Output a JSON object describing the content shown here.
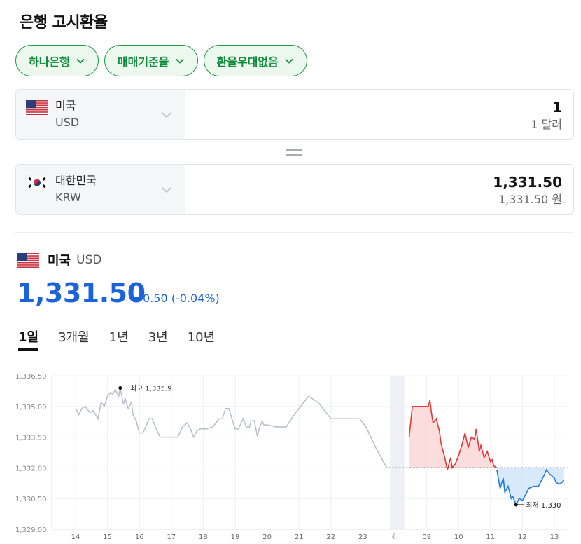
{
  "page_title": "은행 고시환율",
  "filters": [
    {
      "label": "하나은행"
    },
    {
      "label": "매매기준율"
    },
    {
      "label": "환율우대없음"
    }
  ],
  "from_currency": {
    "name": "미국",
    "code": "USD",
    "amount": "1",
    "amount_sub": "1 달러"
  },
  "to_currency": {
    "name": "대한민국",
    "code": "KRW",
    "amount": "1,331.50",
    "amount_sub": "1,331.50 원"
  },
  "summary": {
    "name": "미국",
    "code": "USD",
    "price": "1,331.50",
    "change": "0.50 (-0.04%)",
    "change_direction": "down"
  },
  "period_tabs": [
    {
      "label": "1일",
      "active": true
    },
    {
      "label": "3개월",
      "active": false
    },
    {
      "label": "1년",
      "active": false
    },
    {
      "label": "3년",
      "active": false
    },
    {
      "label": "10년",
      "active": false
    }
  ],
  "colors": {
    "accent_green": "#0d8a3a",
    "price_blue": "#1a63d8",
    "up_red": "#e53935",
    "down_blue": "#1e7be0",
    "history_gray": "#b7bcc9"
  },
  "chart_data": {
    "type": "line",
    "ylim": [
      1329.0,
      1336.5
    ],
    "yticks": [
      "1,336.50",
      "1,335.00",
      "1,333.50",
      "1,332.00",
      "1,330.50",
      "1,329.00"
    ],
    "xticks": [
      "14",
      "15",
      "16",
      "17",
      "18",
      "19",
      "20",
      "21",
      "22",
      "23",
      "☾",
      "09",
      "10",
      "11",
      "12",
      "13"
    ],
    "reference_value": 1332.0,
    "max_label": "최고 1,335.9",
    "min_label": "최저 1,330",
    "series": [
      {
        "x": [
          0.0,
          0.1,
          0.2,
          0.3,
          0.45,
          0.55,
          0.7,
          0.8,
          0.9,
          1.0,
          1.1,
          1.15,
          1.25,
          1.35,
          1.4,
          1.5,
          1.55,
          1.65,
          1.75,
          1.8,
          1.9,
          2.0,
          2.1,
          2.2,
          2.3,
          2.4,
          2.5,
          2.65,
          2.8,
          2.9,
          3.05,
          3.2,
          3.35,
          3.5,
          3.6,
          3.7,
          3.8,
          3.9,
          4.1,
          4.3,
          4.5,
          4.6,
          4.7,
          4.8,
          4.9,
          5.0,
          5.1,
          5.25,
          5.35,
          5.45,
          5.5,
          5.6,
          5.7,
          5.75,
          5.85,
          5.9,
          6.0,
          6.3,
          6.6,
          6.8,
          7.0,
          7.3,
          7.6,
          8.0,
          8.4,
          8.7,
          8.9,
          9.1,
          9.4,
          9.75
        ],
        "y": [
          1334.9,
          1334.6,
          1334.9,
          1335.0,
          1334.7,
          1334.8,
          1334.4,
          1335.2,
          1335.0,
          1335.5,
          1335.7,
          1335.6,
          1335.8,
          1335.5,
          1335.9,
          1335.1,
          1335.4,
          1334.9,
          1335.2,
          1334.6,
          1334.3,
          1333.7,
          1333.7,
          1334.0,
          1334.4,
          1334.4,
          1334.0,
          1333.5,
          1333.5,
          1333.5,
          1333.5,
          1333.5,
          1334.0,
          1334.2,
          1333.9,
          1333.5,
          1333.8,
          1333.9,
          1333.9,
          1334.0,
          1334.4,
          1334.4,
          1334.9,
          1334.9,
          1334.4,
          1333.9,
          1333.9,
          1334.4,
          1334.0,
          1334.0,
          1334.3,
          1334.3,
          1333.5,
          1333.9,
          1334.3,
          1334.1,
          1334.1,
          1334.0,
          1334.0,
          1334.5,
          1334.9,
          1335.5,
          1335.2,
          1334.4,
          1334.4,
          1334.4,
          1334.4,
          1334.0,
          1333.0,
          1332.0
        ]
      },
      {
        "x": [
          10.45,
          10.55,
          10.7,
          10.9,
          11.05,
          11.1,
          11.15,
          11.2,
          11.3,
          11.4,
          11.45,
          11.55,
          11.65,
          11.75,
          11.8,
          11.9,
          12.0,
          12.1,
          12.2,
          12.3,
          12.4,
          12.5,
          12.55,
          12.65,
          12.7,
          12.8,
          12.9,
          13.0,
          13.05,
          13.1,
          13.2
        ],
        "y": [
          1333.5,
          1335.0,
          1335.0,
          1335.0,
          1335.0,
          1335.3,
          1334.7,
          1334.2,
          1334.4,
          1333.8,
          1333.2,
          1332.6,
          1331.9,
          1332.5,
          1332.0,
          1332.2,
          1332.6,
          1333.1,
          1333.7,
          1333.0,
          1333.5,
          1333.4,
          1333.9,
          1332.8,
          1333.1,
          1332.5,
          1332.8,
          1332.3,
          1332.4,
          1332.1,
          1332.0
        ]
      },
      {
        "x": [
          13.2,
          13.3,
          13.4,
          13.45,
          13.55,
          13.65,
          13.7,
          13.8,
          13.9,
          14.0,
          14.1,
          14.2,
          14.35,
          14.5,
          14.6,
          14.7,
          14.75,
          14.85,
          15.0,
          15.05,
          15.15,
          15.25,
          15.3
        ],
        "y": [
          1331.9,
          1331.0,
          1331.5,
          1330.8,
          1331.1,
          1330.5,
          1330.6,
          1330.2,
          1330.5,
          1330.4,
          1330.7,
          1331.0,
          1331.1,
          1331.1,
          1331.4,
          1331.7,
          1331.9,
          1331.7,
          1331.5,
          1331.3,
          1331.2,
          1331.3,
          1331.4
        ]
      }
    ]
  }
}
